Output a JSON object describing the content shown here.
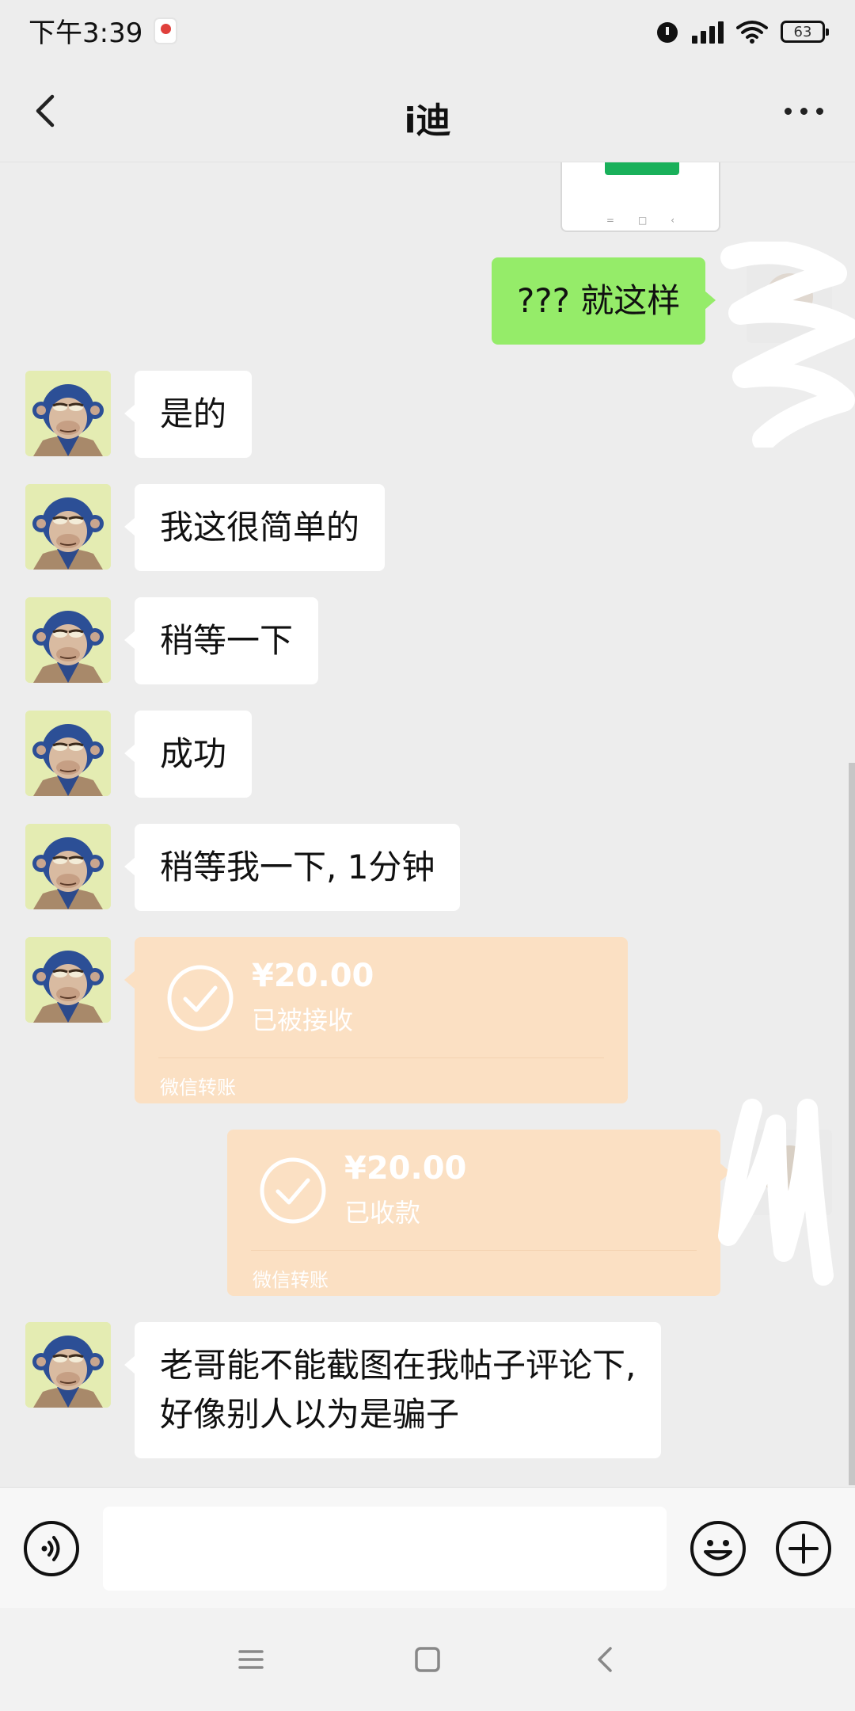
{
  "status_bar": {
    "time": "下午3:39",
    "battery": "63"
  },
  "header": {
    "title": "i迪"
  },
  "messages": [
    {
      "text": "??? 就这样"
    },
    {
      "text": "是的"
    },
    {
      "text": "我这很简单的"
    },
    {
      "text": "稍等一下"
    },
    {
      "text": "成功"
    },
    {
      "text": "稍等我一下, 1分钟"
    },
    {
      "amount": "¥20.00",
      "status": "已被接收",
      "label": "微信转账"
    },
    {
      "amount": "¥20.00",
      "status": "已收款",
      "label": "微信转账"
    },
    {
      "line1": "老哥能不能截图在我帖子评论下,",
      "line2": "好像别人以为是骗子"
    }
  ],
  "colors": {
    "sent_bubble": "#95ec69",
    "received_bubble": "#ffffff",
    "transfer_card": "#fbe0c3",
    "background": "#ededed"
  },
  "icons": {
    "back": "back-arrow-icon",
    "more": "more-icon",
    "voice": "voice-icon",
    "emoji": "emoji-icon",
    "plus": "plus-icon",
    "transfer": "check-circle-icon"
  }
}
